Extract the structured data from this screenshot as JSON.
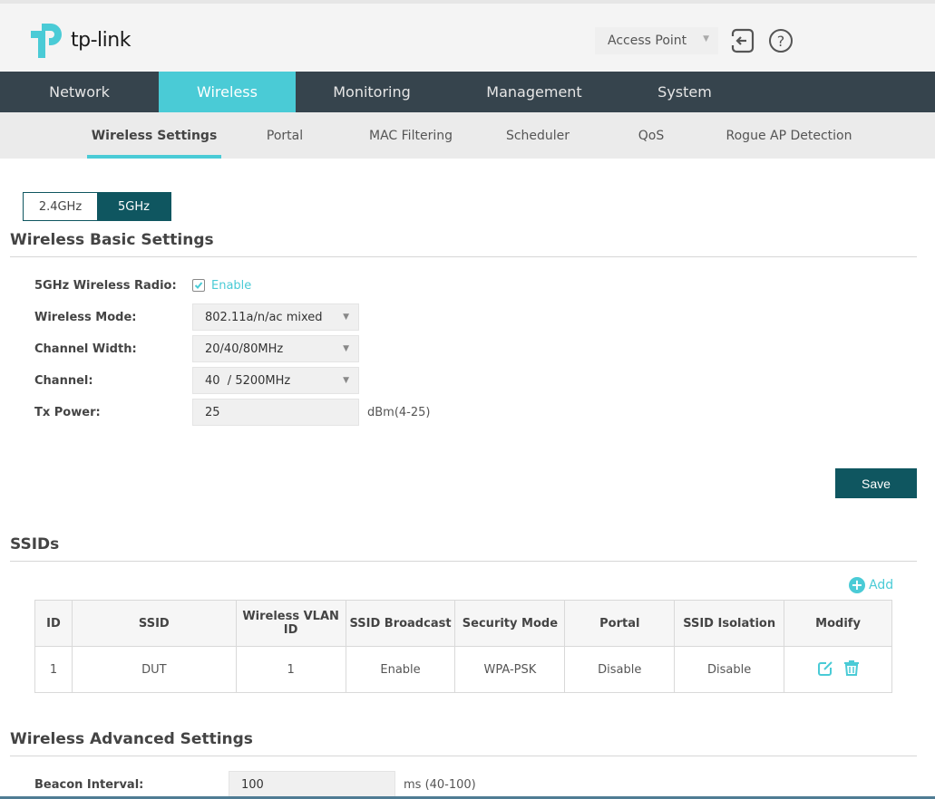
{
  "header": {
    "brand": "tp-link",
    "mode_select": "Access Point",
    "logout_icon": "logout-icon",
    "help_icon": "help-icon"
  },
  "main_nav": [
    {
      "label": "Network",
      "active": false
    },
    {
      "label": "Wireless",
      "active": true
    },
    {
      "label": "Monitoring",
      "active": false
    },
    {
      "label": "Management",
      "active": false
    },
    {
      "label": "System",
      "active": false
    }
  ],
  "sub_nav": [
    {
      "label": "Wireless Settings",
      "active": true
    },
    {
      "label": "Portal",
      "active": false
    },
    {
      "label": "MAC Filtering",
      "active": false
    },
    {
      "label": "Scheduler",
      "active": false
    },
    {
      "label": "QoS",
      "active": false
    },
    {
      "label": "Rogue AP Detection",
      "active": false
    }
  ],
  "band_tabs": [
    {
      "label": "2.4GHz",
      "active": false
    },
    {
      "label": "5GHz",
      "active": true
    }
  ],
  "basic": {
    "title": "Wireless Basic Settings",
    "radio_label": "5GHz Wireless Radio:",
    "radio_checkbox_label": "Enable",
    "radio_enabled": true,
    "mode_label": "Wireless Mode:",
    "mode_value": "802.11a/n/ac mixed",
    "width_label": "Channel Width:",
    "width_value": "20/40/80MHz",
    "channel_label": "Channel:",
    "channel_value": "40  / 5200MHz",
    "tx_label": "Tx Power:",
    "tx_value": "25",
    "tx_hint": "dBm(4-25)",
    "save_label": "Save"
  },
  "ssids": {
    "title": "SSIDs",
    "add_label": "Add",
    "columns": [
      "ID",
      "SSID",
      "Wireless VLAN ID",
      "SSID Broadcast",
      "Security Mode",
      "Portal",
      "SSID Isolation",
      "Modify"
    ],
    "rows": [
      {
        "id": "1",
        "ssid": "DUT",
        "vlan": "1",
        "broadcast": "Enable",
        "security": "WPA-PSK",
        "portal": "Disable",
        "isolation": "Disable"
      }
    ]
  },
  "advanced": {
    "title": "Wireless Advanced Settings",
    "beacon_label": "Beacon Interval:",
    "beacon_value": "100",
    "beacon_hint": "ms (40-100)"
  },
  "colors": {
    "accent": "#4acbd6",
    "nav_bg": "#36444d",
    "primary_button": "#0f5660"
  }
}
